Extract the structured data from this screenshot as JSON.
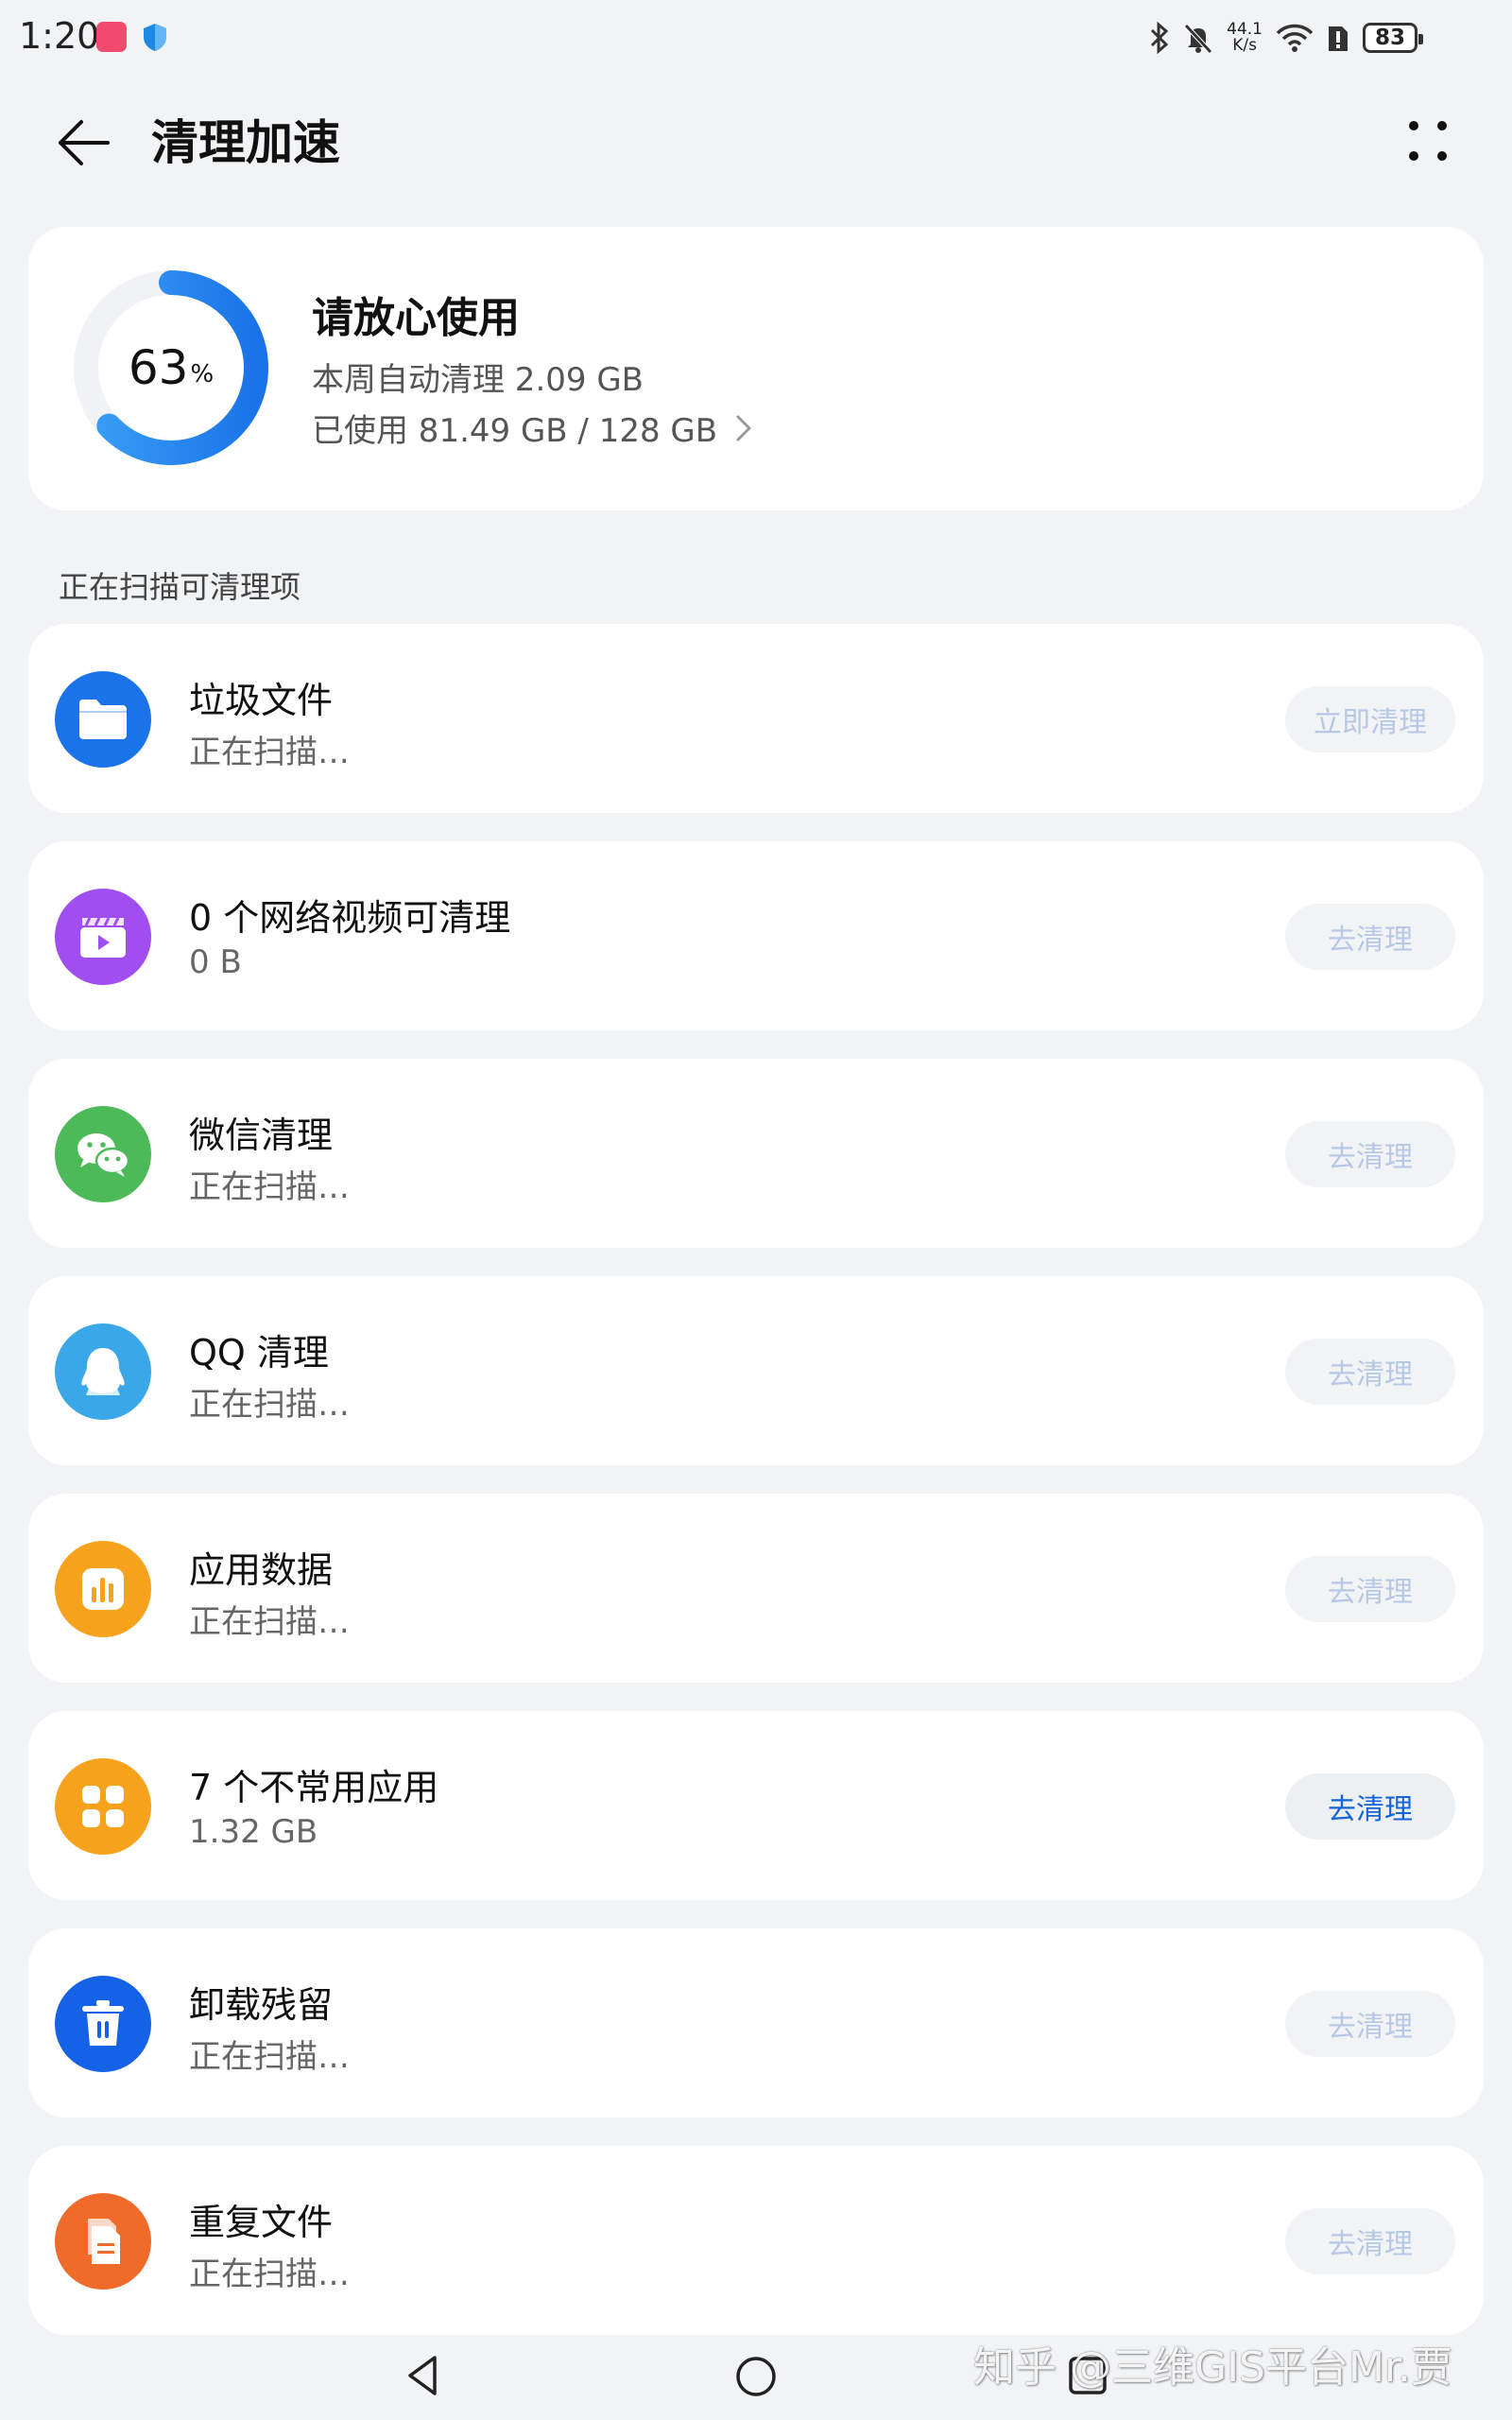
{
  "status_bar": {
    "time": "1:20",
    "net_speed_value": "44.1",
    "net_speed_unit": "K/s",
    "battery": "83"
  },
  "header": {
    "title": "清理加速"
  },
  "storage": {
    "percent": "63",
    "percent_sign": "%",
    "percent_value": 0.63,
    "headline": "请放心使用",
    "auto_clean": "本周自动清理 2.09 GB",
    "used": "已使用 81.49 GB / 128 GB"
  },
  "section_title": "正在扫描可清理项",
  "items": [
    {
      "title": "垃圾文件",
      "subtitle": "正在扫描…",
      "button": "立即清理",
      "icon": "folder-icon",
      "color": "#1a73e8"
    },
    {
      "title": "0 个网络视频可清理",
      "subtitle": "0 B",
      "button": "去清理",
      "icon": "video-icon",
      "color": "#a04ef0"
    },
    {
      "title": "微信清理",
      "subtitle": "正在扫描…",
      "button": "去清理",
      "icon": "wechat-icon",
      "color": "#4cba58"
    },
    {
      "title": "QQ 清理",
      "subtitle": "正在扫描…",
      "button": "去清理",
      "icon": "qq-icon",
      "color": "#3aa8e8"
    },
    {
      "title": "应用数据",
      "subtitle": "正在扫描…",
      "button": "去清理",
      "icon": "app-data-icon",
      "color": "#f7a21c"
    },
    {
      "title": "7 个不常用应用",
      "subtitle": "1.32 GB",
      "button": "去清理",
      "icon": "apps-grid-icon",
      "color": "#f7a21c"
    },
    {
      "title": "卸载残留",
      "subtitle": "正在扫描…",
      "button": "去清理",
      "icon": "trash-icon",
      "color": "#1463e6"
    },
    {
      "title": "重复文件",
      "subtitle": "正在扫描…",
      "button": "去清理",
      "icon": "duplicate-file-icon",
      "color": "#f06a2a"
    }
  ],
  "watermark": "知乎 @三维GIS平台Mr.贾"
}
